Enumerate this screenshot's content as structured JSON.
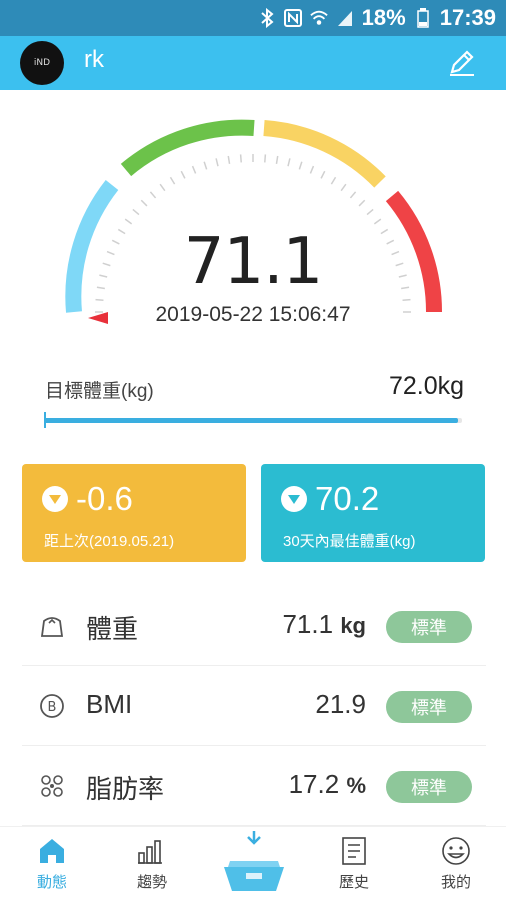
{
  "status_bar": {
    "battery": "18%",
    "time": "17:39",
    "icons": [
      "bluetooth-icon",
      "nfc-icon",
      "wifi-icon",
      "signal-icon",
      "battery-icon"
    ]
  },
  "header": {
    "avatar_text": "iND",
    "username": "rk",
    "edit_icon": "pencil-icon"
  },
  "gauge": {
    "weight": "71.1",
    "timestamp": "2019-05-22 15:06:47",
    "zone_colors": [
      "#7fd8f7",
      "#6cc24a",
      "#f9d363",
      "#ef4346"
    ],
    "indicator_color": "#e8303a"
  },
  "target": {
    "label": "目標體重(kg)",
    "value": "72.0kg",
    "progress": 0.99
  },
  "cards": [
    {
      "value": "-0.6",
      "label": "距上次(2019.05.21)",
      "arrow": "down-arrow-icon",
      "color": "#f3bb3c"
    },
    {
      "value": "70.2",
      "label": "30天內最佳體重(kg)",
      "arrow": "down-arrow-icon",
      "color": "#2bbcd1"
    }
  ],
  "metrics": [
    {
      "icon": "weight-icon",
      "name": "體重",
      "value": "71.1",
      "unit": "kg",
      "badge": "標準"
    },
    {
      "icon": "bmi-icon",
      "name": "BMI",
      "value": "21.9",
      "unit": "",
      "badge": "標準"
    },
    {
      "icon": "body-fat-icon",
      "name": "脂肪率",
      "value": "17.2",
      "unit": "%",
      "badge": "標準"
    }
  ],
  "nav": {
    "items": [
      {
        "label": "動態",
        "icon": "home-icon",
        "active": true
      },
      {
        "label": "趨勢",
        "icon": "trend-icon",
        "active": false
      },
      {
        "label": "歷史",
        "icon": "history-icon",
        "active": false
      },
      {
        "label": "我的",
        "icon": "profile-icon",
        "active": false
      }
    ],
    "center_icon": "scale-icon"
  },
  "colors": {
    "primary": "#3cc0ef",
    "statusbar": "#2e8bb8",
    "badge": "#8ec79a"
  }
}
